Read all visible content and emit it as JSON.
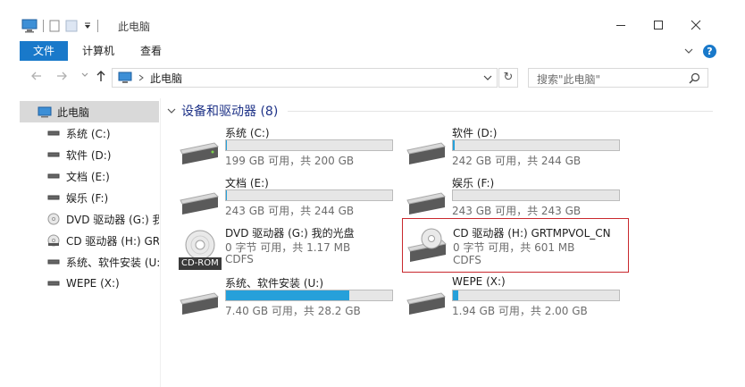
{
  "window": {
    "title": "此电脑"
  },
  "ribbon": {
    "file_tab": "文件",
    "computer_tab": "计算机",
    "view_tab": "查看",
    "help": "?"
  },
  "nav": {
    "address": "此电脑",
    "search_placeholder": "搜索\"此电脑\""
  },
  "sidebar": {
    "items": [
      {
        "label": "此电脑",
        "icon": "computer-icon",
        "selected": true
      },
      {
        "label": "系统 (C:)",
        "icon": "drive-icon"
      },
      {
        "label": "软件 (D:)",
        "icon": "drive-icon"
      },
      {
        "label": "文档 (E:)",
        "icon": "drive-icon"
      },
      {
        "label": "娱乐 (F:)",
        "icon": "drive-icon"
      },
      {
        "label": "DVD 驱动器 (G:) 我",
        "icon": "dvd-icon"
      },
      {
        "label": "CD 驱动器 (H:) GR",
        "icon": "cd-icon"
      },
      {
        "label": "系统、软件安装 (U:",
        "icon": "drive-icon"
      },
      {
        "label": "WEPE (X:)",
        "icon": "drive-icon"
      }
    ]
  },
  "main": {
    "group_title": "设备和驱动器 (8)",
    "drives": [
      {
        "name": "系统 (C:)",
        "info": "199 GB 可用，共 200 GB",
        "used_fraction": 0.005
      },
      {
        "name": "软件 (D:)",
        "info": "242 GB 可用，共 244 GB",
        "used_fraction": 0.01
      },
      {
        "name": "文档 (E:)",
        "info": "243 GB 可用，共 244 GB",
        "used_fraction": 0.004
      },
      {
        "name": "娱乐 (F:)",
        "info": "243 GB 可用，共 243 GB",
        "used_fraction": 0.0
      },
      {
        "name": "DVD 驱动器 (G:) 我的光盘",
        "info": "0 字节 可用，共 1.17 MB",
        "fs": "CDFS",
        "badge": "CD-ROM"
      },
      {
        "name": "CD 驱动器 (H:) GRTMPVOL_CN",
        "info": "0 字节 可用，共 601 MB",
        "fs": "CDFS"
      },
      {
        "name": "系统、软件安装 (U:)",
        "info": "7.40 GB 可用，共 28.2 GB",
        "used_fraction": 0.74
      },
      {
        "name": "WEPE (X:)",
        "info": "1.94 GB 可用，共 2.00 GB",
        "used_fraction": 0.03
      }
    ]
  },
  "colors": {
    "accent": "#1979ca",
    "bar_fill": "#26a0da",
    "highlight_border": "#c9282d",
    "group_title": "#1e3287"
  }
}
